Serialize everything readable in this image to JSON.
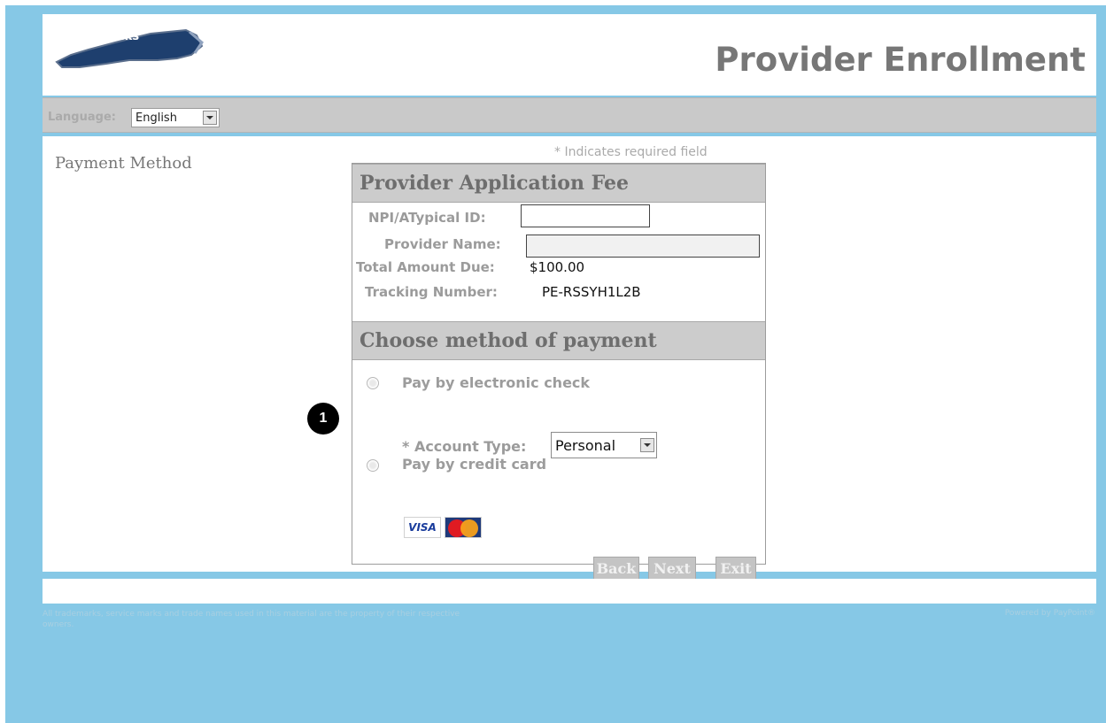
{
  "header": {
    "logo_text": "NCTracks",
    "title": "Provider Enrollment"
  },
  "language_bar": {
    "label": "Language:",
    "selected": "English"
  },
  "sidebar": {
    "title": "Payment Method"
  },
  "form": {
    "required_note": "* Indicates required field",
    "fee_section": {
      "title": "Provider Application Fee",
      "npi_label": "NPI/ATypical ID:",
      "npi_value": "",
      "provider_name_label": "Provider Name:",
      "provider_name_value": "",
      "total_label": "Total Amount Due:",
      "total_value": "$100.00",
      "tracking_label": "Tracking Number:",
      "tracking_value": "PE-RSSYH1L2B"
    },
    "payment_section": {
      "title": "Choose method of payment",
      "option_echeck": "Pay by electronic check",
      "account_type_label": "* Account Type:",
      "account_type_value": "Personal",
      "option_credit": "Pay by credit card",
      "card_visa": "VISA",
      "card_mastercard": "MasterCard"
    },
    "buttons": {
      "back": "Back",
      "next": "Next",
      "exit": "Exit"
    }
  },
  "footer": {
    "left_text": "All trademarks, service marks and trade names used in this material are the property of their respective owners.",
    "right_text": "Powered by PayPoint®"
  },
  "callout": {
    "number": "1"
  },
  "colors": {
    "background": "#86c8e6",
    "section_header": "#cccccc",
    "title_text": "#777777"
  }
}
